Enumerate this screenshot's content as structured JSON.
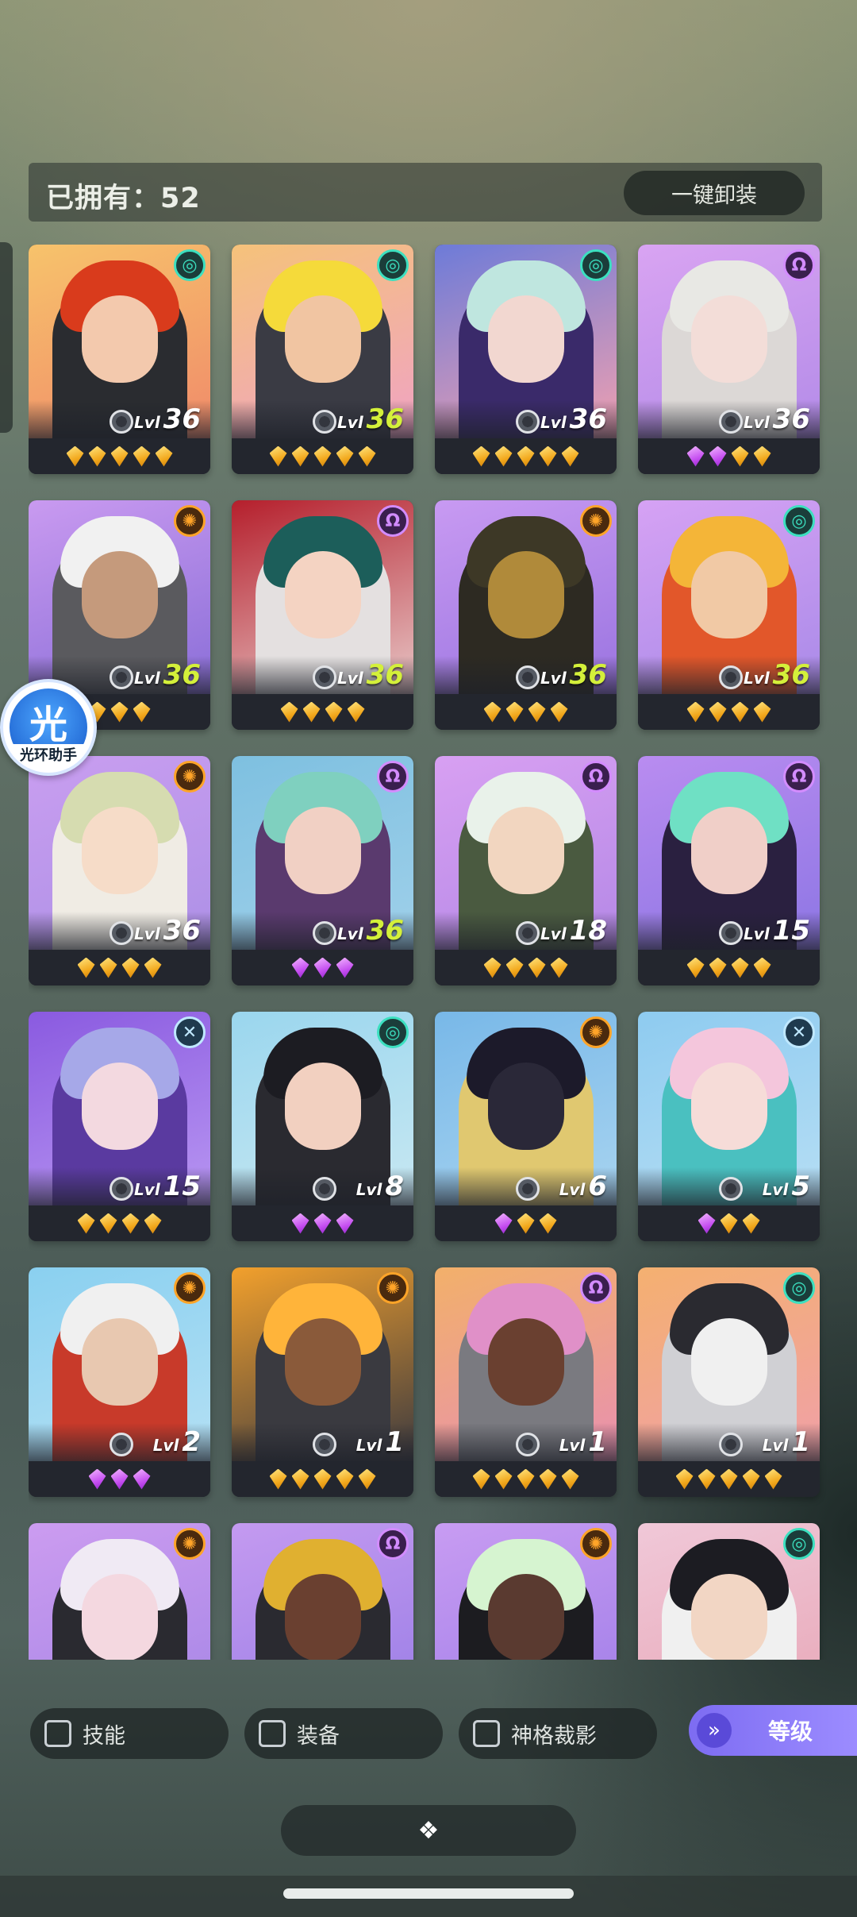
{
  "header": {
    "owned_label": "已拥有：52",
    "unequip_label": "一键卸装"
  },
  "assistant": {
    "glyph": "光",
    "label": "光环助手"
  },
  "filters": [
    {
      "label": "技能",
      "checked": false
    },
    {
      "label": "装备",
      "checked": false
    },
    {
      "label": "神格裁影",
      "checked": false
    }
  ],
  "sort": {
    "label": "等级",
    "icon": "chevron-double-down-icon"
  },
  "expand": {
    "icon": "diamond-cluster-icon",
    "glyph": "❖"
  },
  "level_prefix": "Lvl",
  "heroes": [
    {
      "level": 36,
      "gems": [
        "gold",
        "gold",
        "gold",
        "gold",
        "gold"
      ],
      "badge": "teal",
      "bg": [
        "#f7c36b",
        "#f08a6a"
      ],
      "hair": "#d93b1c",
      "skin": "#f3c9ad",
      "body": "#2a2c30"
    },
    {
      "level": 36,
      "gems": [
        "gold",
        "gold",
        "gold",
        "gold",
        "gold"
      ],
      "badge": "teal",
      "bg": [
        "#f5c27a",
        "#f0a3c4"
      ],
      "hair": "#f5da3a",
      "skin": "#f1c5a2",
      "body": "#3a3b44"
    },
    {
      "level": 36,
      "gems": [
        "gold",
        "gold",
        "gold",
        "gold",
        "gold"
      ],
      "badge": "teal",
      "bg": [
        "#6d7bd8",
        "#f0a0b0"
      ],
      "hair": "#bfe6df",
      "skin": "#f2d7d0",
      "body": "#3a2a6a"
    },
    {
      "level": 36,
      "gems": [
        "purple",
        "purple",
        "gold",
        "gold"
      ],
      "badge": "purple",
      "bg": [
        "#d9a4f2",
        "#b38be8"
      ],
      "hair": "#e8e8e4",
      "skin": "#f3ddd8",
      "body": "#dcd8d6"
    },
    {
      "level": 36,
      "gems": [
        "gold",
        "gold",
        "gold"
      ],
      "badge": "orange",
      "bg": [
        "#c99af0",
        "#8a6ed8"
      ],
      "hair": "#f1f1f1",
      "skin": "#c59a7c",
      "body": "#5a5a5e"
    },
    {
      "level": 36,
      "gems": [
        "gold",
        "gold",
        "gold",
        "gold"
      ],
      "badge": "purple",
      "bg": [
        "#b51f2c",
        "#e8c8c8"
      ],
      "hair": "#1c5e5a",
      "skin": "#f4d3c2",
      "body": "#e4e0e0"
    },
    {
      "level": 36,
      "gems": [
        "gold",
        "gold",
        "gold",
        "gold"
      ],
      "badge": "orange",
      "bg": [
        "#c89af2",
        "#9a74e0"
      ],
      "hair": "#3d3826",
      "skin": "#b08a3a",
      "body": "#2d2a22"
    },
    {
      "level": 36,
      "gems": [
        "gold",
        "gold",
        "gold",
        "gold"
      ],
      "badge": "teal",
      "bg": [
        "#d6a2f4",
        "#a98ae8"
      ],
      "hair": "#f4b538",
      "skin": "#f1c9a5",
      "body": "#e2572a"
    },
    {
      "level": 36,
      "gems": [
        "gold",
        "gold",
        "gold",
        "gold"
      ],
      "badge": "orange",
      "bg": [
        "#c99ef0",
        "#ad90e6"
      ],
      "hair": "#d6dcb0",
      "skin": "#f6dcc8",
      "body": "#f0ece4"
    },
    {
      "level": 36,
      "gems": [
        "purple",
        "purple",
        "purple"
      ],
      "badge": "purple",
      "bg": [
        "#7ec0e0",
        "#9fd0ea"
      ],
      "hair": "#7fd0bf",
      "skin": "#f1d0c4",
      "body": "#5a3a6e"
    },
    {
      "level": 18,
      "gems": [
        "gold",
        "gold",
        "gold",
        "gold"
      ],
      "badge": "purple",
      "bg": [
        "#d8a0f2",
        "#b488e6"
      ],
      "hair": "#e9f2ea",
      "skin": "#f2d6c0",
      "body": "#4a5a40"
    },
    {
      "level": 15,
      "gems": [
        "gold",
        "gold",
        "gold",
        "gold"
      ],
      "badge": "purple",
      "bg": [
        "#b98cf0",
        "#8d76e4"
      ],
      "hair": "#6fe0c4",
      "skin": "#f0cfc8",
      "body": "#2a2040"
    },
    {
      "level": 15,
      "gems": [
        "gold",
        "gold",
        "gold",
        "gold"
      ],
      "badge": "cross",
      "bg": [
        "#8a5ae0",
        "#b896f2"
      ],
      "hair": "#a6a8e8",
      "skin": "#f3d9e0",
      "body": "#5a3aa0"
    },
    {
      "level": 8,
      "gems": [
        "purple",
        "purple",
        "purple"
      ],
      "badge": "teal",
      "bg": [
        "#9ad6ee",
        "#c8e8f2"
      ],
      "hair": "#1c1c22",
      "skin": "#f2d0c0",
      "body": "#2a2a30"
    },
    {
      "level": 6,
      "gems": [
        "purple",
        "gold",
        "gold"
      ],
      "badge": "orange",
      "bg": [
        "#78b8e8",
        "#a8d4f0"
      ],
      "hair": "#1c1a2a",
      "skin": "#2a2838",
      "body": "#e0c870"
    },
    {
      "level": 5,
      "gems": [
        "purple",
        "gold",
        "gold"
      ],
      "badge": "cross",
      "bg": [
        "#8ecbf0",
        "#b6def4"
      ],
      "hair": "#f4c6dc",
      "skin": "#f6dcd8",
      "body": "#4ac0c0"
    },
    {
      "level": 2,
      "gems": [
        "purple",
        "purple",
        "purple"
      ],
      "badge": "orange",
      "bg": [
        "#8ad0f0",
        "#b4e0f4"
      ],
      "hair": "#f0f0f0",
      "skin": "#e8c8b0",
      "body": "#c83a2a"
    },
    {
      "level": 1,
      "gems": [
        "gold",
        "gold",
        "gold",
        "gold",
        "gold"
      ],
      "badge": "orange",
      "bg": [
        "#f2a02c",
        "#3c3a40"
      ],
      "hair": "#ffb43a",
      "skin": "#8a5a3a",
      "body": "#3a3a40"
    },
    {
      "level": 1,
      "gems": [
        "gold",
        "gold",
        "gold",
        "gold",
        "gold"
      ],
      "badge": "purple",
      "bg": [
        "#f2b06a",
        "#e890b0"
      ],
      "hair": "#e090c8",
      "skin": "#6a4030",
      "body": "#7a7a80"
    },
    {
      "level": 1,
      "gems": [
        "gold",
        "gold",
        "gold",
        "gold",
        "gold"
      ],
      "badge": "teal",
      "bg": [
        "#f4b070",
        "#f0a0a8"
      ],
      "hair": "#2a2a30",
      "skin": "#f0f0f0",
      "body": "#d0d0d4"
    },
    {
      "level": null,
      "gems": [],
      "badge": "orange",
      "bg": [
        "#cc9cf0",
        "#a686e6"
      ],
      "hair": "#f0eaf4",
      "skin": "#f4d8e0",
      "body": "#2a2a30"
    },
    {
      "level": null,
      "gems": [],
      "badge": "purple",
      "bg": [
        "#c49af0",
        "#9a7ee6"
      ],
      "hair": "#e0b030",
      "skin": "#6a4030",
      "body": "#2a2a30"
    },
    {
      "level": null,
      "gems": [],
      "badge": "orange",
      "bg": [
        "#c89cf2",
        "#a07ee8"
      ],
      "hair": "#d6f4d0",
      "skin": "#5a3a30",
      "body": "#1c1c20"
    },
    {
      "level": null,
      "gems": [],
      "badge": "teal",
      "bg": [
        "#f0c8d8",
        "#e8a8b8"
      ],
      "hair": "#1c1c22",
      "skin": "#f2d6c4",
      "body": "#f0f0f0"
    }
  ]
}
